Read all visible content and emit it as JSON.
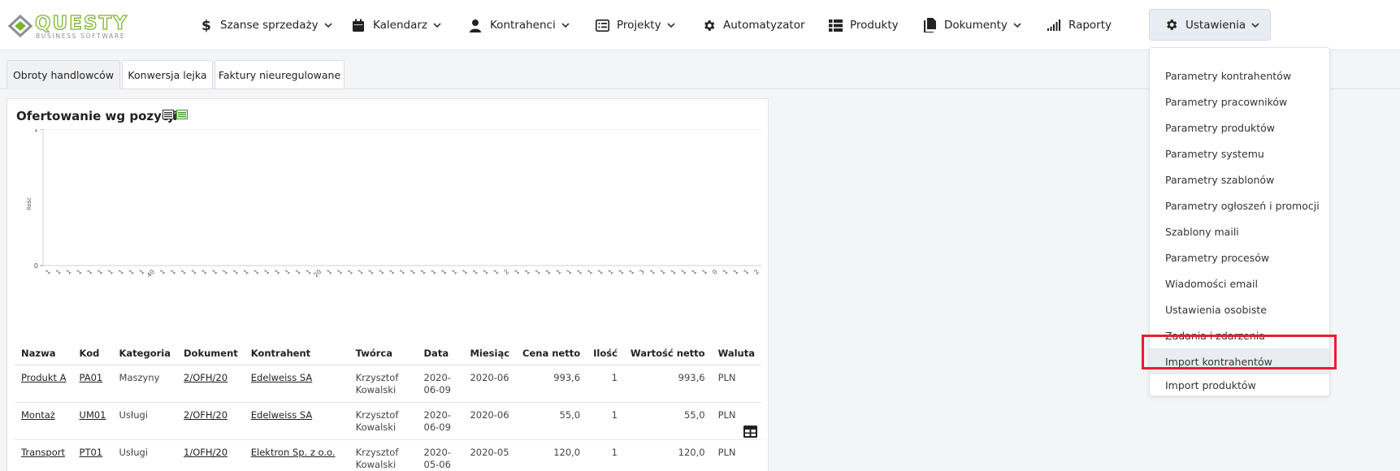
{
  "logo": {
    "word": "QUESTY",
    "sub": "BUSINESS SOFTWARE"
  },
  "nav": {
    "items": [
      {
        "label": "Szanse sprzedaży",
        "icon": "dollar-icon",
        "has_chevron": true
      },
      {
        "label": "Kalendarz",
        "icon": "calendar-icon",
        "has_chevron": true
      },
      {
        "label": "Kontrahenci",
        "icon": "user-icon",
        "has_chevron": true
      },
      {
        "label": "Projekty",
        "icon": "list-icon",
        "has_chevron": true
      },
      {
        "label": "Automatyzator",
        "icon": "gear-icon",
        "has_chevron": false
      },
      {
        "label": "Produkty",
        "icon": "grid-list-icon",
        "has_chevron": false
      },
      {
        "label": "Dokumenty",
        "icon": "documents-icon",
        "has_chevron": true
      },
      {
        "label": "Raporty",
        "icon": "signal-bars-icon",
        "has_chevron": false
      },
      {
        "label": "Ustawienia",
        "icon": "gear-icon",
        "has_chevron": true,
        "active": true
      }
    ]
  },
  "tabs": [
    {
      "label": "Obroty handlowców",
      "active": true
    },
    {
      "label": "Konwersja lejka",
      "active": false
    },
    {
      "label": "Faktury nieuregulowane",
      "active": false
    }
  ],
  "card": {
    "title": "Ofertowanie wg pozycji",
    "export_icons": [
      "xls-icon",
      "csv-icon"
    ]
  },
  "chart_data": {
    "type": "bar",
    "title": "",
    "ylabel": "Ilość",
    "xlabel": "",
    "ylim": [
      0,
      1
    ],
    "y_ticks": [
      "1",
      "0"
    ],
    "categories": [
      "1",
      "1",
      "1",
      "1",
      "1",
      "1",
      "1",
      "1",
      "1",
      "1",
      "40",
      "1",
      "1",
      "1",
      "1",
      "1",
      "1",
      "1",
      "1",
      "1",
      "1",
      "1",
      "1",
      "1",
      "1",
      "1",
      "20",
      "1",
      "1",
      "1",
      "1",
      "1",
      "1",
      "1",
      "1",
      "1",
      "1",
      "1",
      "1",
      "1",
      "1",
      "1",
      "1",
      "1",
      "2",
      "1",
      "1",
      "1",
      "1",
      "1",
      "1",
      "1",
      "1",
      "1",
      "1",
      "1",
      "1",
      "3",
      "1",
      "1",
      "1",
      "1",
      "1",
      "1",
      "0",
      "1",
      "1",
      "1",
      "2"
    ],
    "values": [],
    "grid": true
  },
  "table": {
    "columns": [
      "Nazwa",
      "Kod",
      "Kategoria",
      "Dokument",
      "Kontrahent",
      "Twórca",
      "Data",
      "Miesiąc",
      "Cena netto",
      "Ilość",
      "Wartość netto",
      "Waluta"
    ],
    "rows": [
      {
        "nazwa": "Produkt A",
        "kod": "PA01",
        "kategoria": "Maszyny",
        "dokument": "2/OFH/20",
        "kontrahent": "Edelweiss SA",
        "tworca": "Krzysztof Kowalski",
        "data": "2020-06-09",
        "miesiac": "2020-06",
        "cena": "993,6",
        "ilosc": "1",
        "wartosc": "993,6",
        "waluta": "PLN"
      },
      {
        "nazwa": "Montaż",
        "kod": "UM01",
        "kategoria": "Usługi",
        "dokument": "2/OFH/20",
        "kontrahent": "Edelweiss SA",
        "tworca": "Krzysztof Kowalski",
        "data": "2020-06-09",
        "miesiac": "2020-06",
        "cena": "55,0",
        "ilosc": "1",
        "wartosc": "55,0",
        "waluta": "PLN"
      },
      {
        "nazwa": "Transport",
        "kod": "PT01",
        "kategoria": "Usługi",
        "dokument": "1/OFH/20",
        "kontrahent": "Elektron Sp. z o.o.",
        "tworca": "Krzysztof Kowalski",
        "data": "2020-05-06",
        "miesiac": "2020-05",
        "cena": "120,0",
        "ilosc": "1",
        "wartosc": "120,0",
        "waluta": "PLN"
      }
    ]
  },
  "settings_menu": {
    "items": [
      "Parametry kontrahentów",
      "Parametry pracowników",
      "Parametry produktów",
      "Parametry systemu",
      "Parametry szablonów",
      "Parametry ogłoszeń i promocji",
      "Szablony maili",
      "Parametry procesów",
      "Wiadomości email",
      "Ustawienia osobiste",
      "Zadania i zdarzenia",
      "Import kontrahentów",
      "Import produktów"
    ],
    "highlighted_index": 11
  },
  "colors": {
    "brand_green": "#7fb52e",
    "highlight_red": "#e5202e",
    "hover_bg": "#e9edf2"
  }
}
